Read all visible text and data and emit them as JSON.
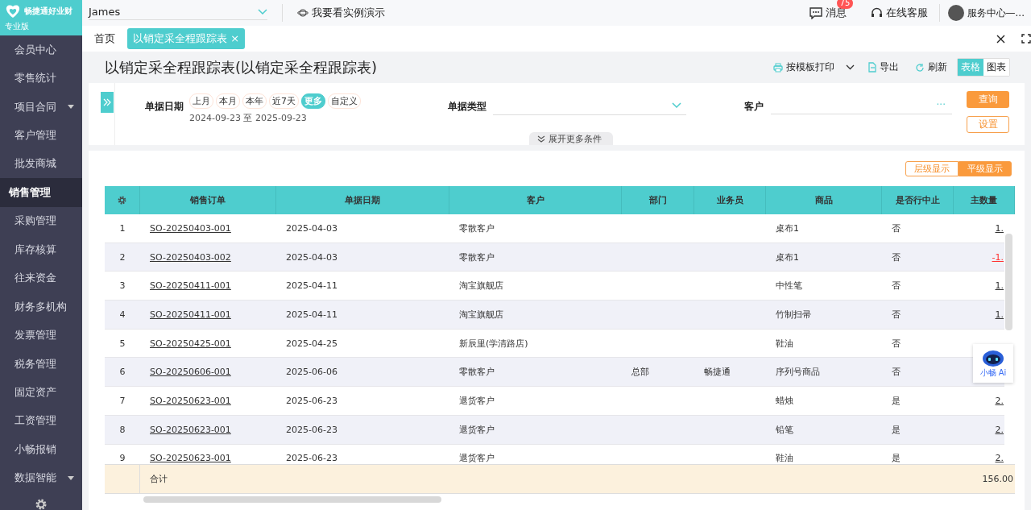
{
  "brand": {
    "name": "畅捷通好业财",
    "edition": "专业版"
  },
  "sidebar": {
    "items": [
      {
        "label": "会员中心",
        "selected": false,
        "expandable": false
      },
      {
        "label": "零售统计",
        "selected": false,
        "expandable": false
      },
      {
        "label": "项目合同",
        "selected": false,
        "expandable": true
      },
      {
        "label": "客户管理",
        "selected": false,
        "expandable": false
      },
      {
        "label": "批发商城",
        "selected": false,
        "expandable": false
      },
      {
        "label": "销售管理",
        "selected": true,
        "expandable": false
      },
      {
        "label": "采购管理",
        "selected": false,
        "expandable": false
      },
      {
        "label": "库存核算",
        "selected": false,
        "expandable": false
      },
      {
        "label": "往来资金",
        "selected": false,
        "expandable": false
      },
      {
        "label": "财务多机构",
        "selected": false,
        "expandable": false
      },
      {
        "label": "发票管理",
        "selected": false,
        "expandable": false
      },
      {
        "label": "税务管理",
        "selected": false,
        "expandable": false
      },
      {
        "label": "固定资产",
        "selected": false,
        "expandable": false
      },
      {
        "label": "工资管理",
        "selected": false,
        "expandable": false
      },
      {
        "label": "小畅报销",
        "selected": false,
        "expandable": false
      },
      {
        "label": "数据智能",
        "selected": false,
        "expandable": true
      }
    ]
  },
  "header": {
    "account": "James",
    "demo": "我要看实例演示",
    "messages": "消息",
    "message_count": "75",
    "support": "在线客服",
    "user": "服务中心—..."
  },
  "tabs": [
    {
      "label": "首页",
      "selected": false,
      "closable": false
    },
    {
      "label": "以销定采全程跟踪表",
      "selected": true,
      "closable": true
    }
  ],
  "close_icon": "×",
  "page_title": "以销定采全程跟踪表(以销定采全程跟踪表)",
  "toolbar": {
    "print": "按模板打印",
    "export": "导出",
    "refresh": "刷新",
    "views": [
      {
        "label": "表格",
        "selected": true
      },
      {
        "label": "图表",
        "selected": false
      }
    ]
  },
  "filters": {
    "date_label": "单据日期",
    "periods": [
      {
        "label": "上月",
        "selected": false
      },
      {
        "label": "本月",
        "selected": false
      },
      {
        "label": "本年",
        "selected": false
      },
      {
        "label": "近7天",
        "selected": false
      },
      {
        "label": "更多",
        "selected": true
      },
      {
        "label": "自定义",
        "selected": false
      }
    ],
    "date_range": "2024-09-23 至 2025-09-23",
    "type_label": "单据类型",
    "customer_label": "客户",
    "more_icon": "···",
    "query": "查询",
    "settings": "设置",
    "expand": "展开更多条件"
  },
  "display_modes": [
    {
      "label": "层级显示",
      "selected": false
    },
    {
      "label": "平级显示",
      "selected": true
    }
  ],
  "table": {
    "columns": [
      "销售订单",
      "单据日期",
      "客户",
      "部门",
      "业务员",
      "商品",
      "是否行中止",
      "主数量"
    ],
    "rows": [
      {
        "index": "1",
        "order": "SO-20250403-001",
        "date": "2025-04-03",
        "customer": "零散客户",
        "dept": "",
        "sales": "",
        "product": "桌布1",
        "stopped": "否",
        "qty": "1.",
        "negative": false
      },
      {
        "index": "2",
        "order": "SO-20250403-002",
        "date": "2025-04-03",
        "customer": "零散客户",
        "dept": "",
        "sales": "",
        "product": "桌布1",
        "stopped": "否",
        "qty": "-1.",
        "negative": true
      },
      {
        "index": "3",
        "order": "SO-20250411-001",
        "date": "2025-04-11",
        "customer": "淘宝旗舰店",
        "dept": "",
        "sales": "",
        "product": "中性笔",
        "stopped": "否",
        "qty": "1.",
        "negative": false
      },
      {
        "index": "4",
        "order": "SO-20250411-001",
        "date": "2025-04-11",
        "customer": "淘宝旗舰店",
        "dept": "",
        "sales": "",
        "product": "竹制扫帚",
        "stopped": "否",
        "qty": "1.",
        "negative": false
      },
      {
        "index": "5",
        "order": "SO-20250425-001",
        "date": "2025-04-25",
        "customer": "新辰里(学清路店)",
        "dept": "",
        "sales": "",
        "product": "鞋油",
        "stopped": "否",
        "qty": ""
      },
      {
        "index": "6",
        "order": "SO-20250606-001",
        "date": "2025-06-06",
        "customer": "零散客户",
        "dept": "总部",
        "sales": "畅捷通",
        "product": "序列号商品",
        "stopped": "否",
        "qty": ""
      },
      {
        "index": "7",
        "order": "SO-20250623-001",
        "date": "2025-06-23",
        "customer": "退货客户",
        "dept": "",
        "sales": "",
        "product": "蜡烛",
        "stopped": "是",
        "qty": "2.",
        "negative": false
      },
      {
        "index": "8",
        "order": "SO-20250623-001",
        "date": "2025-06-23",
        "customer": "退货客户",
        "dept": "",
        "sales": "",
        "product": "铅笔",
        "stopped": "是",
        "qty": "2.",
        "negative": false
      },
      {
        "index": "9",
        "order": "SO-20250623-001",
        "date": "2025-06-23",
        "customer": "退货客户",
        "dept": "",
        "sales": "",
        "product": "鞋油",
        "stopped": "是",
        "qty": "2.",
        "negative": false
      }
    ],
    "total_label": "合计",
    "total_qty": "156.00"
  },
  "assistant": {
    "label": "小畅 Ai"
  }
}
